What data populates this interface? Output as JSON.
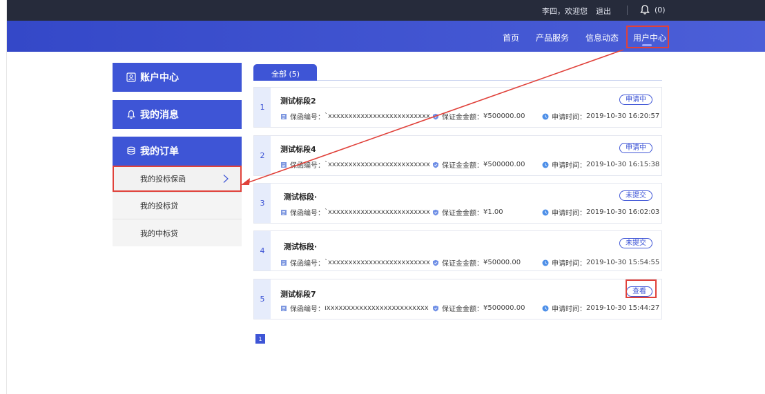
{
  "topbar": {
    "welcome": "李四，欢迎您",
    "logout": "退出",
    "notification_count": "(0)"
  },
  "nav": {
    "items": [
      {
        "label": "首页"
      },
      {
        "label": "产品服务"
      },
      {
        "label": "信息动态"
      },
      {
        "label": "用户中心"
      }
    ]
  },
  "sidebar": {
    "account_center": "账户中心",
    "my_messages": "我的消息",
    "my_orders": "我的订单",
    "sub_items": [
      {
        "label": "我的投标保函"
      },
      {
        "label": "我的投标贷"
      },
      {
        "label": "我的中标贷"
      }
    ]
  },
  "tabs": {
    "all_label": "全部 (5)"
  },
  "labels": {
    "guarantee_no": "保函编号：",
    "deposit_amount": "保证金金额：",
    "apply_time": "申请时间："
  },
  "orders": [
    {
      "index": "1",
      "title": "测试标段2",
      "guarantee_no": "`xxxxxxxxxxxxxxxxxxxxxxxxx",
      "amount": "¥500000.00",
      "time": "2019-10-30 16:20:57",
      "status": "申请中"
    },
    {
      "index": "2",
      "title": "测试标段4",
      "guarantee_no": "`xxxxxxxxxxxxxxxxxxxxxxxxx",
      "amount": "¥500000.00",
      "time": "2019-10-30 16:15:38",
      "status": "申请中"
    },
    {
      "index": "3",
      "title": "测试标段·",
      "guarantee_no": "`xxxxxxxxxxxxxxxxxxxxxxxxx",
      "amount": "¥1.00",
      "time": "2019-10-30 16:02:03",
      "status": "未提交"
    },
    {
      "index": "4",
      "title": "测试标段·",
      "guarantee_no": "`xxxxxxxxxxxxxxxxxxxxxxxxx",
      "amount": "¥50000.00",
      "time": "2019-10-30 15:54:55",
      "status": "未提交"
    },
    {
      "index": "5",
      "title": "测试标段7",
      "guarantee_no": "ıxxxxxxxxxxxxxxxxxxxxxxxxx",
      "amount": "¥500000.00",
      "time": "2019-10-30 15:44:27",
      "status": "查看"
    }
  ],
  "pager": {
    "current": "1"
  },
  "colors": {
    "topbar": "#262b3b",
    "nav": "#3c50d2",
    "accent": "#3e55d6",
    "annotation": "#e0413a"
  },
  "icons": {
    "bell": "bell-icon",
    "account": "account-icon",
    "message": "bell-icon",
    "orders": "orders-icon",
    "chevron": "chevron-right-icon",
    "guarantee": "document-icon",
    "amount": "shield-icon",
    "time": "clock-icon"
  }
}
